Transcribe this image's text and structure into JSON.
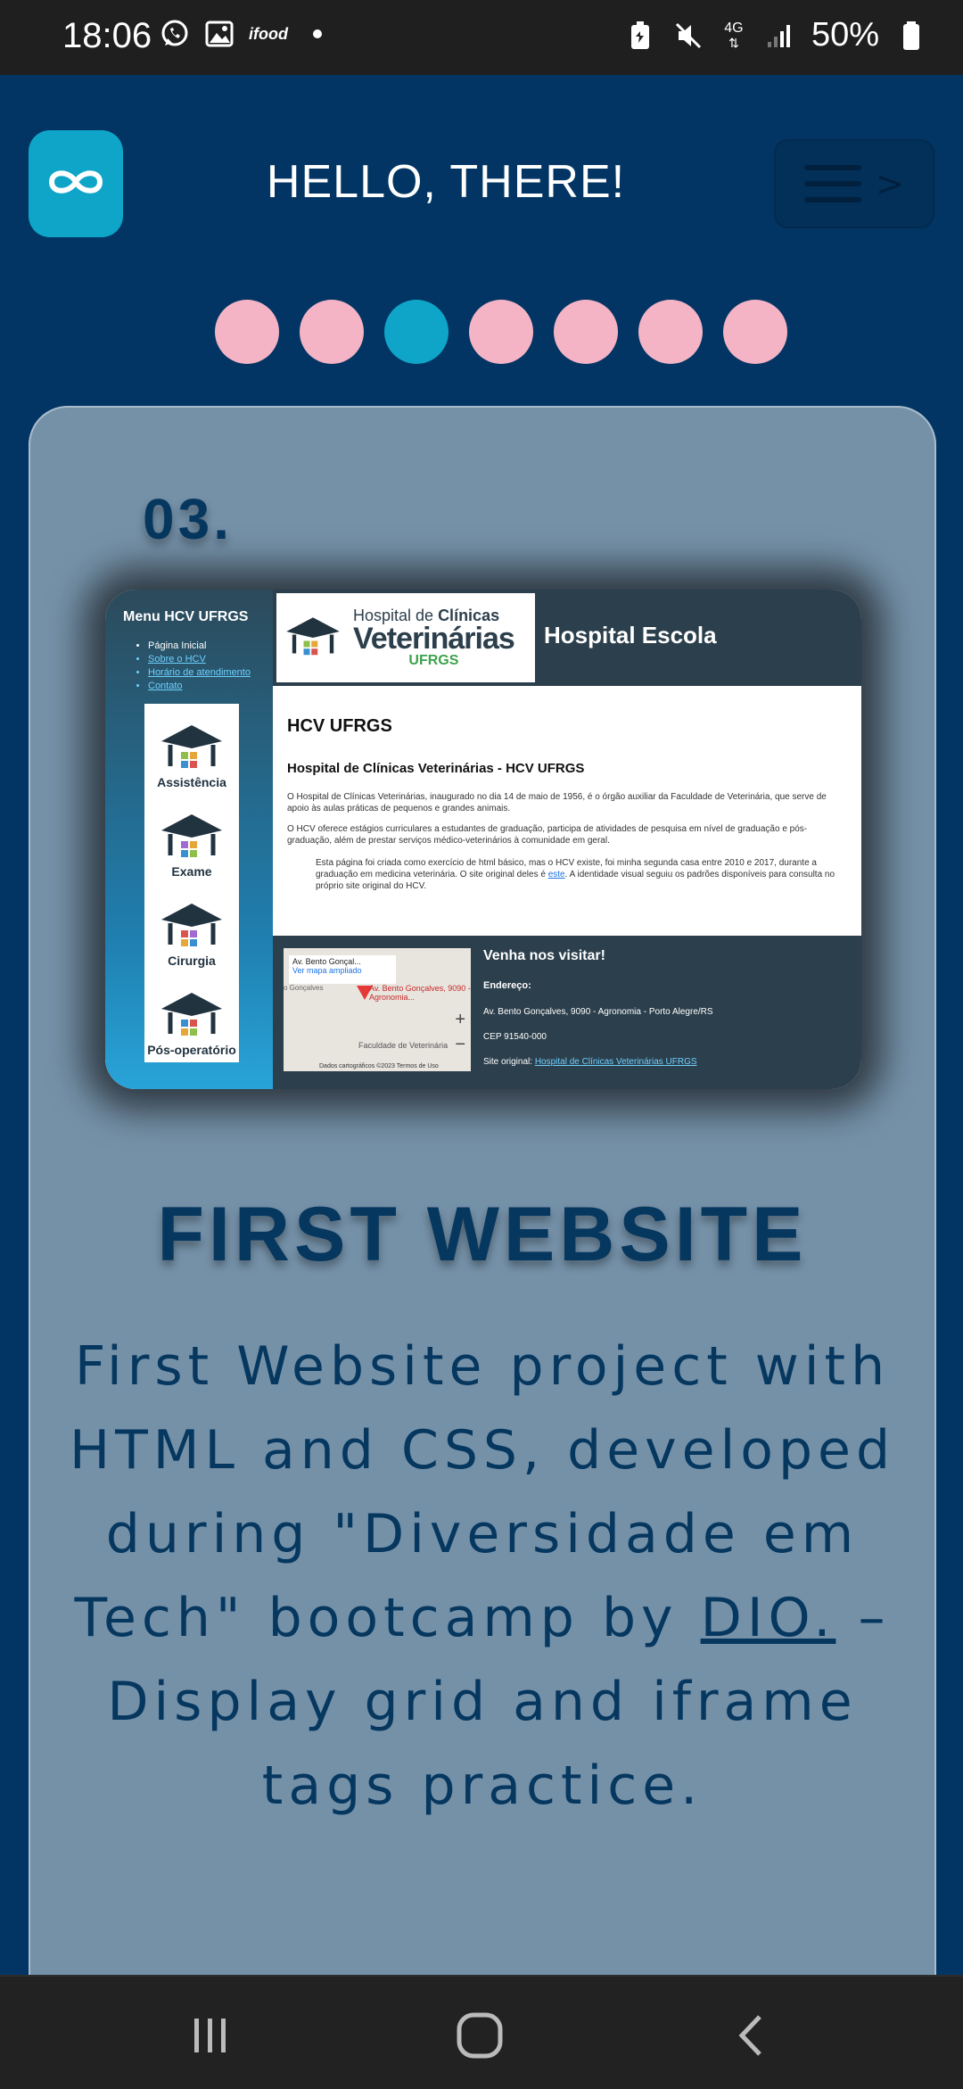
{
  "status_bar": {
    "time": "18:06",
    "left_icons": [
      "whatsapp-icon",
      "gallery-icon",
      "ifood-icon",
      "dot-icon"
    ],
    "ifood_label": "ifood",
    "right_icons": [
      "battery-saver-icon",
      "mute-icon",
      "4g-icon",
      "signal-icon",
      "battery-icon"
    ],
    "network_label": "4G",
    "battery": "50%"
  },
  "header": {
    "logo_icon": "infinity-icon",
    "title": "HELLO, THERE!",
    "menu_arrow": ">"
  },
  "carousel": {
    "dot_count": 7,
    "active_index": 2,
    "colors": {
      "dot": "#f4b4c5",
      "active": "#0ea5c9"
    }
  },
  "card": {
    "number": "03.",
    "preview": {
      "menu_title": "Menu HCV UFRGS",
      "menu_items": [
        "Página Inicial",
        "Sobre o HCV",
        "Horário de atendimento",
        "Contato"
      ],
      "tiles": [
        "Assistência",
        "Exame",
        "Cirurgia",
        "Pós-operatório"
      ],
      "brand_line1": "Hospital de ",
      "brand_line1_bold": "Clínicas",
      "brand_line2": "Veterinárias",
      "brand_line3": "UFRGS",
      "header_right": "Hospital Escola",
      "h1": "HCV UFRGS",
      "h2": "Hospital de Clínicas Veterinárias - HCV UFRGS",
      "p1": "O Hospital de Clínicas Veterinárias, inaugurado no dia 14 de maio de 1956, é o órgão auxiliar da Faculdade de Veterinária, que serve de apoio às aulas práticas de pequenos e grandes animais.",
      "p2": "O HCV oferece estágios curriculares a estudantes de graduação, participa de atividades de pesquisa em nível de graduação e pós-graduação, além de prestar serviços médico-veterinários à comunidade em geral.",
      "p3_before": "Esta página foi criada como exercício de html básico, mas o HCV existe, foi minha segunda casa entre 2010 e 2017, durante a graduação em medicina veterinária. O site original deles é ",
      "p3_link": "este",
      "p3_after": ". A identidade visual seguiu os padrões disponíveis para consulta no próprio site original do HCV.",
      "map_place": "Av. Bento Gonçal...",
      "map_link": "Ver mapa ampliado",
      "map_pin_label": "Av. Bento Gonçalves, 9090 - Agronomia...",
      "map_street": "o Gonçalves",
      "map_poi": "Faculdade de Veterinária",
      "map_attribution": "Dados cartográficos ©2023   Termos de Uso",
      "visit_title": "Venha nos visitar!",
      "address_label": "Endereço:",
      "address": "Av. Bento Gonçalves, 9090 - Agronomia - Porto Alegre/RS",
      "cep": "CEP 91540-000",
      "original_label": "Site original: ",
      "original_link": "Hospital de Clínicas Veterinárias UFRGS"
    },
    "title": "FIRST WEBSITE",
    "description_before": "First Website project with HTML and CSS, developed during \"Diversidade em Tech\" bootcamp by ",
    "description_link": "DIO.",
    "description_after": " – Display grid and iframe tags practice."
  },
  "nav_bar": {
    "buttons": [
      "recent-apps-icon",
      "home-icon",
      "back-icon"
    ]
  }
}
